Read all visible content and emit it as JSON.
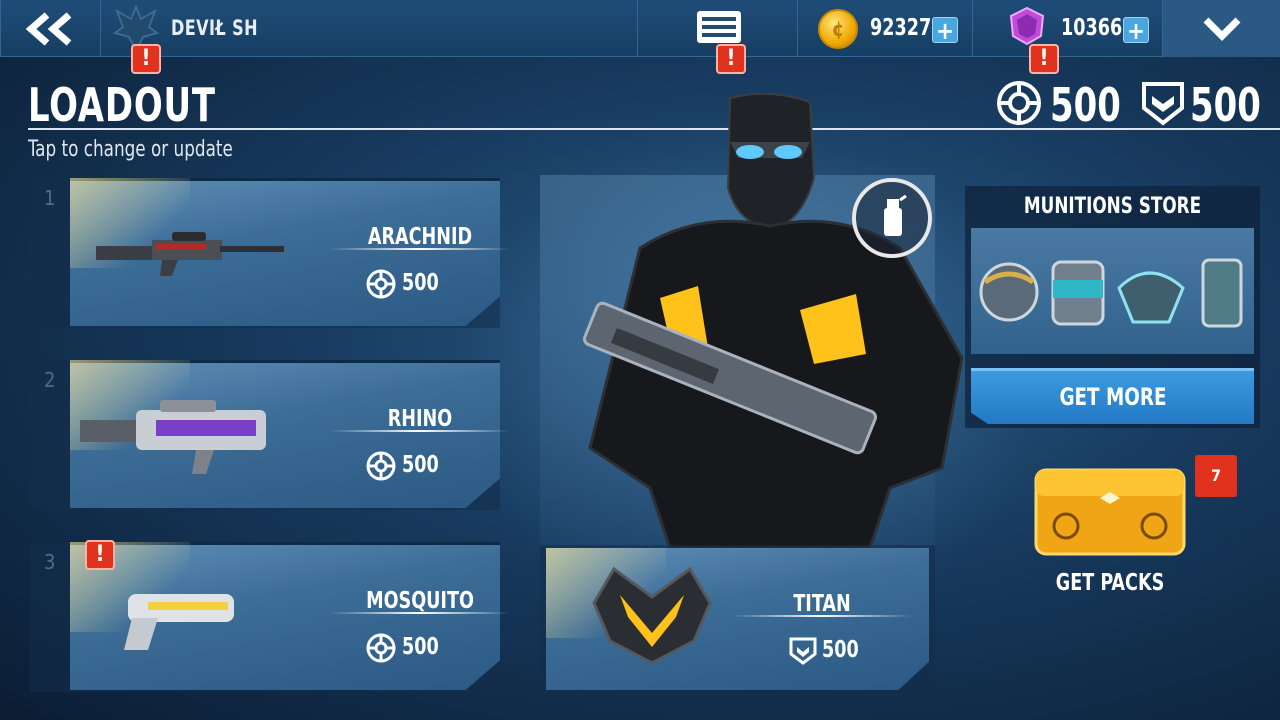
{
  "topbar": {
    "player_name": "DEVIŁ SH",
    "gold": "92327",
    "gems": "10366",
    "plus": "+"
  },
  "header": {
    "title": "LOADOUT",
    "subtitle": "Tap to change or update",
    "weapon_power": "500",
    "armor_power": "500"
  },
  "weapons": [
    {
      "slot": "1",
      "name": "ARACHNID",
      "cost": "500"
    },
    {
      "slot": "2",
      "name": "RHINO",
      "cost": "500"
    },
    {
      "slot": "3",
      "name": "MOSQUITO",
      "cost": "500"
    }
  ],
  "armor": {
    "name": "TITAN",
    "cost": "500"
  },
  "munitions": {
    "title": "MUNITIONS STORE",
    "button": "GET MORE"
  },
  "packs": {
    "label": "GET PACKS",
    "count": "7"
  },
  "alert_symbol": "!",
  "colors": {
    "accent_blue": "#2f8ad6",
    "alert_red": "#e0321c",
    "armor_glow": "#ffc21a"
  }
}
